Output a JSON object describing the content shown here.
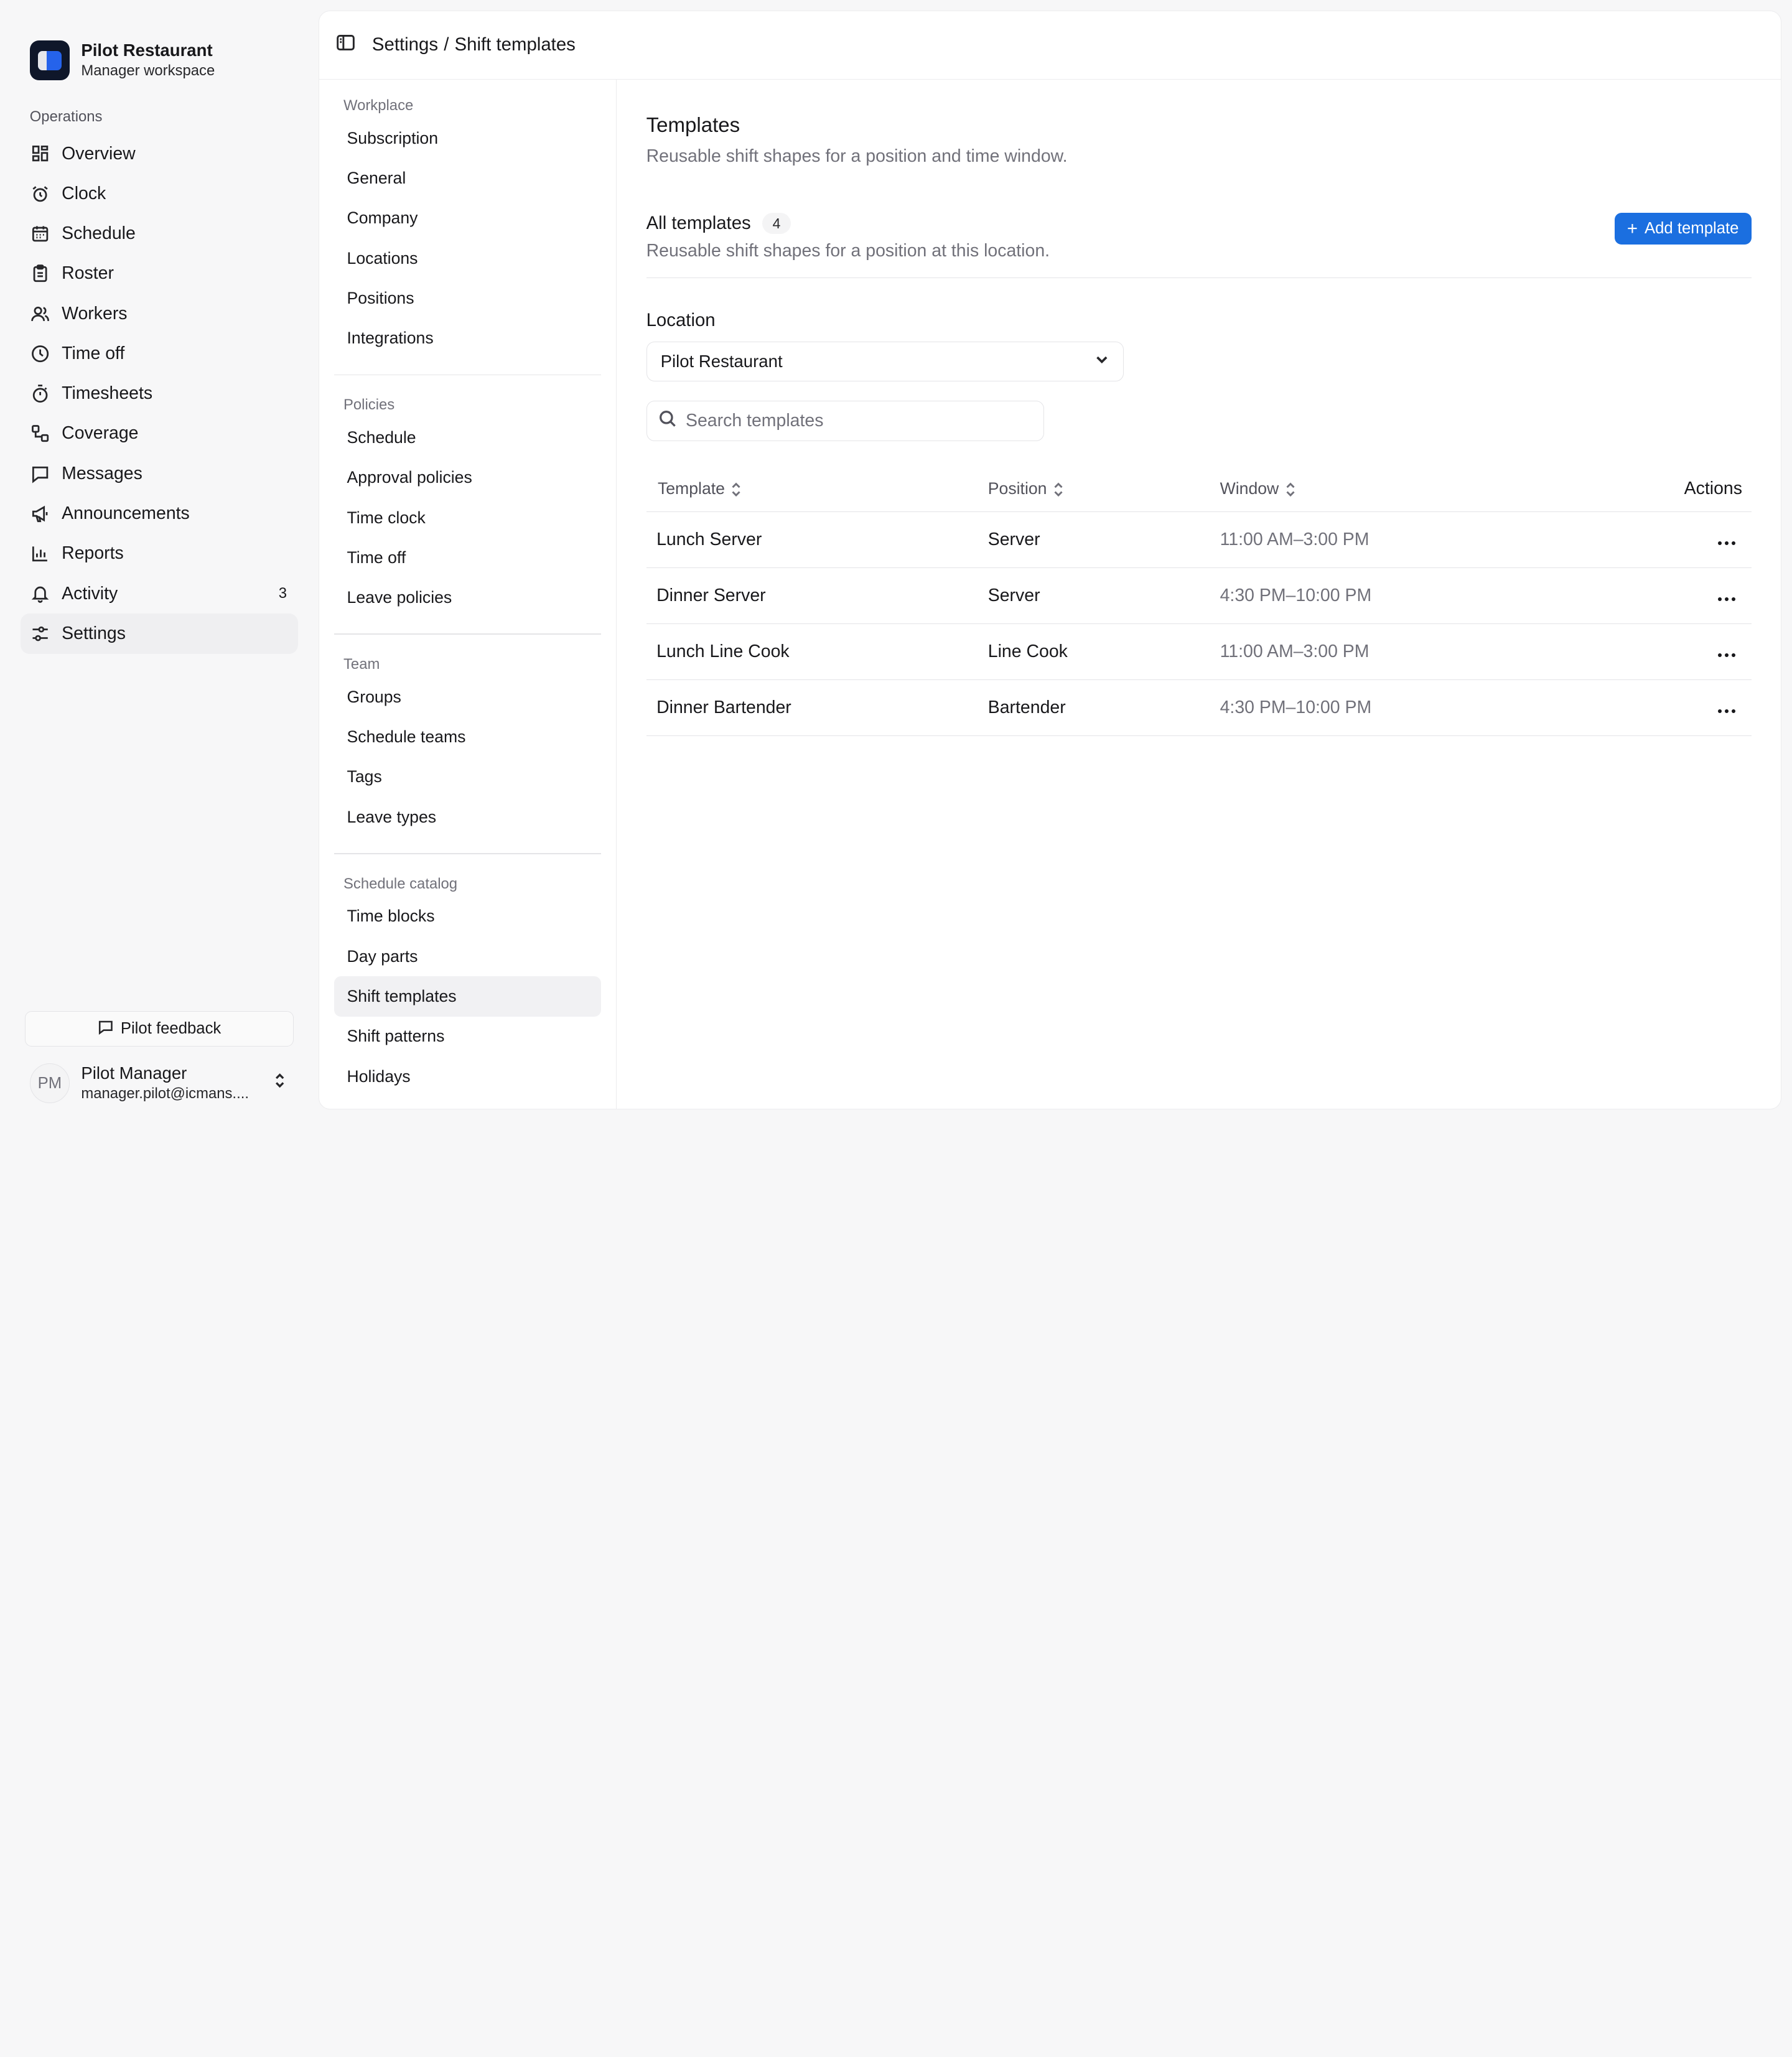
{
  "brand": {
    "name": "Pilot Restaurant",
    "subtitle": "Manager workspace"
  },
  "sidebar": {
    "section_label": "Operations",
    "items": [
      {
        "label": "Overview",
        "icon": "grid-icon"
      },
      {
        "label": "Clock",
        "icon": "alarm-clock-icon"
      },
      {
        "label": "Schedule",
        "icon": "calendar-icon"
      },
      {
        "label": "Roster",
        "icon": "clipboard-icon"
      },
      {
        "label": "Workers",
        "icon": "users-icon"
      },
      {
        "label": "Time off",
        "icon": "clock-icon"
      },
      {
        "label": "Timesheets",
        "icon": "stopwatch-icon"
      },
      {
        "label": "Coverage",
        "icon": "workflow-icon"
      },
      {
        "label": "Messages",
        "icon": "message-icon"
      },
      {
        "label": "Announcements",
        "icon": "megaphone-icon"
      },
      {
        "label": "Reports",
        "icon": "bar-chart-icon"
      },
      {
        "label": "Activity",
        "icon": "bell-icon",
        "badge": "3"
      },
      {
        "label": "Settings",
        "icon": "sliders-icon",
        "active": true
      }
    ],
    "feedback_label": "Pilot feedback",
    "user": {
      "initials": "PM",
      "name": "Pilot Manager",
      "email": "manager.pilot@icmans...."
    }
  },
  "header": {
    "breadcrumb_parent": "Settings",
    "breadcrumb_sep": "/",
    "breadcrumb_current": "Shift templates"
  },
  "settings_nav": {
    "groups": [
      {
        "label": "Workplace",
        "items": [
          "Subscription",
          "General",
          "Company",
          "Locations",
          "Positions",
          "Integrations"
        ]
      },
      {
        "label": "Policies",
        "items": [
          "Schedule",
          "Approval policies",
          "Time clock",
          "Time off",
          "Leave policies"
        ]
      },
      {
        "label": "Team",
        "items": [
          "Groups",
          "Schedule teams",
          "Tags",
          "Leave types"
        ]
      },
      {
        "label": "Schedule catalog",
        "items": [
          "Time blocks",
          "Day parts",
          "Shift templates",
          "Shift patterns",
          "Holidays"
        ]
      }
    ],
    "active": "Shift templates"
  },
  "page": {
    "title": "Templates",
    "description": "Reusable shift shapes for a position and time window.",
    "section_title": "All templates",
    "section_count": "4",
    "section_desc": "Reusable shift shapes for a position at this location.",
    "add_button": "Add template",
    "location_label": "Location",
    "location_value": "Pilot Restaurant",
    "search_placeholder": "Search templates"
  },
  "table": {
    "headers": {
      "template": "Template",
      "position": "Position",
      "window": "Window",
      "actions": "Actions"
    },
    "rows": [
      {
        "template": "Lunch Server",
        "position": "Server",
        "window": "11:00 AM–3:00 PM"
      },
      {
        "template": "Dinner Server",
        "position": "Server",
        "window": "4:30 PM–10:00 PM"
      },
      {
        "template": "Lunch Line Cook",
        "position": "Line Cook",
        "window": "11:00 AM–3:00 PM"
      },
      {
        "template": "Dinner Bartender",
        "position": "Bartender",
        "window": "4:30 PM–10:00 PM"
      }
    ]
  },
  "colors": {
    "accent": "#1b6fe0",
    "active_bg": "#efeff1",
    "muted_text": "#71717a"
  }
}
